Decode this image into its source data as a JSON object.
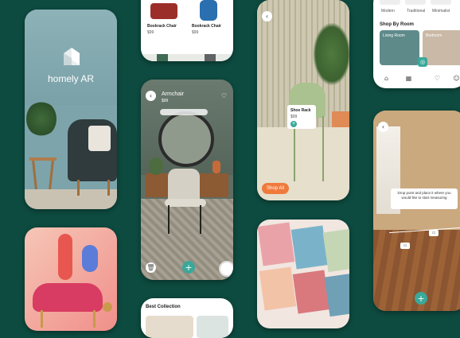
{
  "brand": {
    "name": "homely AR"
  },
  "catalog": {
    "items": [
      {
        "name": "Bookrack Chair",
        "price": "$99"
      },
      {
        "name": "Bookrack Chair",
        "price": "$99"
      }
    ]
  },
  "armchair_screen": {
    "title": "Armchair",
    "price": "$99"
  },
  "shoe_rack_screen": {
    "popup_title": "Shoe Rack",
    "popup_price": "$99",
    "shop_button": "Shop All"
  },
  "room_screen": {
    "styles": [
      "Modern",
      "Traditional",
      "Minimalist"
    ],
    "section_title": "Shop By Room",
    "rooms": [
      "Living Room",
      "Bedroom"
    ]
  },
  "collection_screen": {
    "title": "Best Collection"
  },
  "measure_screen": {
    "instruction": "Drop point and place it where you would like to start measuring"
  },
  "colors": {
    "background": "#0d4a3f",
    "accent": "#3aa89a",
    "orange": "#f07a3c"
  },
  "icons": [
    "chevron-left-icon",
    "heart-icon",
    "plus-icon",
    "trash-icon",
    "shutter-icon",
    "home-icon",
    "grid-icon",
    "user-icon",
    "ruler-icon"
  ]
}
